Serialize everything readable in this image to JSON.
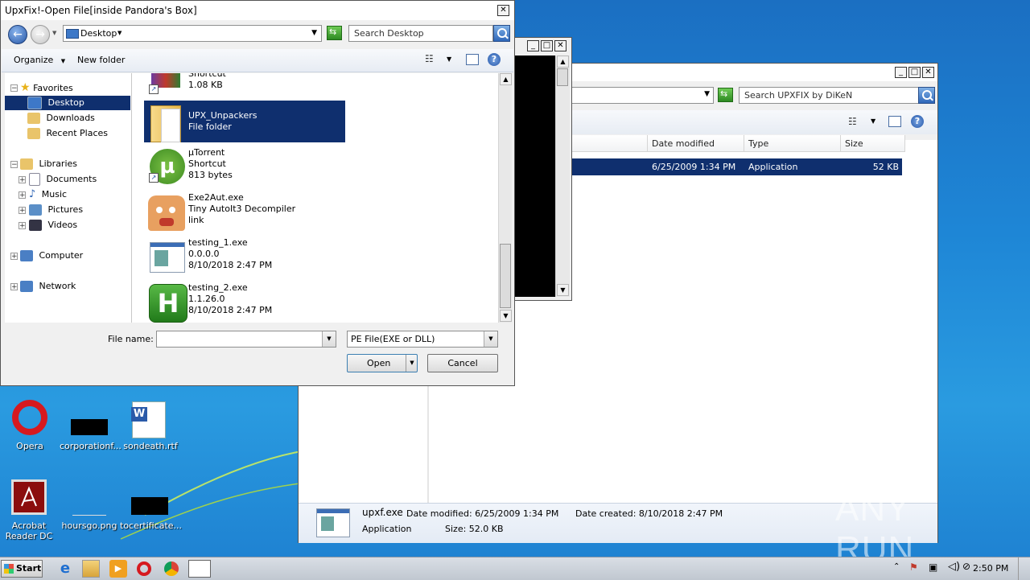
{
  "dialog": {
    "title": "UpxFix!-Open File[inside Pandora's Box]",
    "address": "Desktop",
    "search_placeholder": "Search Desktop",
    "organize": "Organize",
    "new_folder": "New folder",
    "nav": {
      "favorites": "Favorites",
      "desktop": "Desktop",
      "downloads": "Downloads",
      "recent": "Recent Places",
      "libraries": "Libraries",
      "documents": "Documents",
      "music": "Music",
      "pictures": "Pictures",
      "videos": "Videos",
      "computer": "Computer",
      "network": "Network"
    },
    "files": [
      {
        "name": "Shortcut",
        "line2": "1.08 KB",
        "line3": ""
      },
      {
        "name": "UPX_Unpackers",
        "line2": "File folder",
        "line3": ""
      },
      {
        "name": "µTorrent",
        "line2": "Shortcut",
        "line3": "813 bytes"
      },
      {
        "name": "Exe2Aut.exe",
        "line2": "Tiny AutoIt3 Decompiler",
        "line3": "link"
      },
      {
        "name": "testing_1.exe",
        "line2": "0.0.0.0",
        "line3": "8/10/2018 2:47 PM"
      },
      {
        "name": "testing_2.exe",
        "line2": "1.1.26.0",
        "line3": "8/10/2018 2:47 PM"
      }
    ],
    "file_name_label": "File name:",
    "file_name_value": "",
    "file_type": "PE File(EXE or DLL)",
    "open": "Open",
    "cancel": "Cancel"
  },
  "explorer": {
    "search_placeholder": "Search UPXFIX by DiKeN",
    "columns": [
      "Date modified",
      "Type",
      "Size"
    ],
    "row": {
      "date": "6/25/2009 1:34 PM",
      "type": "Application",
      "size": "52 KB"
    },
    "details": {
      "name": "upxf.exe",
      "date_modified": "Date modified: 6/25/2009 1:34 PM",
      "date_created": "Date created: 8/10/2018 2:47 PM",
      "type": "Application",
      "size": "Size: 52.0 KB"
    }
  },
  "desktop": {
    "icons": [
      {
        "label": "Opera"
      },
      {
        "label": "corporationf..."
      },
      {
        "label": "sondeath.rtf"
      },
      {
        "label": "Acrobat Reader DC"
      },
      {
        "label": "hoursgo.png"
      },
      {
        "label": "tocertificate..."
      }
    ],
    "watermark": "ANY RUN"
  },
  "taskbar": {
    "start": "Start",
    "time": "2:50 PM"
  },
  "colors": {
    "selection": "#0f2f6e",
    "desktop_blue": "#1e86d6"
  }
}
